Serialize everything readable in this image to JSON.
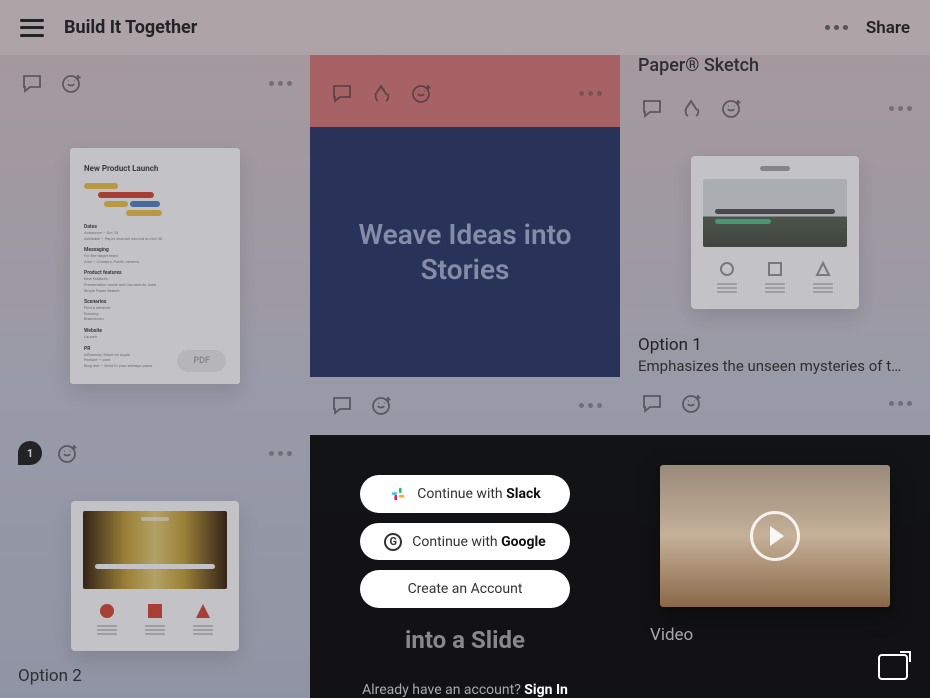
{
  "header": {
    "title": "Build It Together",
    "share": "Share"
  },
  "doc": {
    "title": "New Product Launch"
  },
  "hero": {
    "text": "Weave Ideas into Stories"
  },
  "pdf": "PDF",
  "paper_label": "Paper® Sketch",
  "option1": {
    "title": "Option 1",
    "sub": "Emphasizes the unseen mysteries of t…"
  },
  "option2": {
    "title": "Option 2"
  },
  "comment_count": "1",
  "auth": {
    "slack_pre": "Continue with ",
    "slack_strong": "Slack",
    "google_pre": "Continue with ",
    "google_strong": "Google",
    "create": "Create an Account",
    "slide": "into a Slide",
    "already": "Already have an account? ",
    "signin": "Sign In"
  },
  "video_label": "Video"
}
